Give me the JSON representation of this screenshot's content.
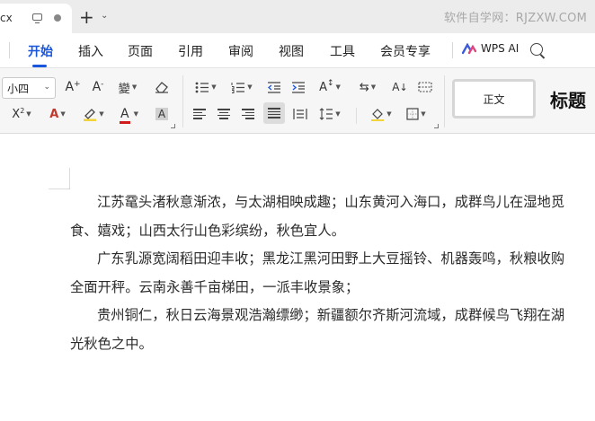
{
  "tab": {
    "title": "cx"
  },
  "watermark": "软件自学网：RJZXW.COM",
  "menu": {
    "items": [
      "开始",
      "插入",
      "页面",
      "引用",
      "审阅",
      "视图",
      "工具",
      "会员专享"
    ],
    "active": "开始",
    "wps_ai": "WPS AI"
  },
  "ribbon": {
    "font_size": "小四",
    "style_normal": "正文",
    "style_title": "标题",
    "colors": {
      "font_color": "#d11a1a",
      "highlight": "#f3d33a",
      "accent": "#1a56db"
    }
  },
  "document": {
    "paragraphs": [
      {
        "line1": "江苏鼋头渚秋意渐浓，与太湖相映成趣；山东黄河入海口，成群鸟儿在湿地",
        "line2": "觅食、嬉戏；山西太行山色彩缤纷，秋色宜人。"
      },
      {
        "line1": "广东乳源宽阔稻田迎丰收；黑龙江黑河田野上大豆摇铃、机器轰鸣，秋粮收",
        "line2": "购全面开秤。云南永善千亩梯田，一派丰收景象；"
      },
      {
        "line1": "贵州铜仁，秋日云海景观浩瀚缥缈；新疆额尔齐斯河流域，成群候鸟飞翔在",
        "line2": "湖光秋色之中。"
      }
    ]
  }
}
